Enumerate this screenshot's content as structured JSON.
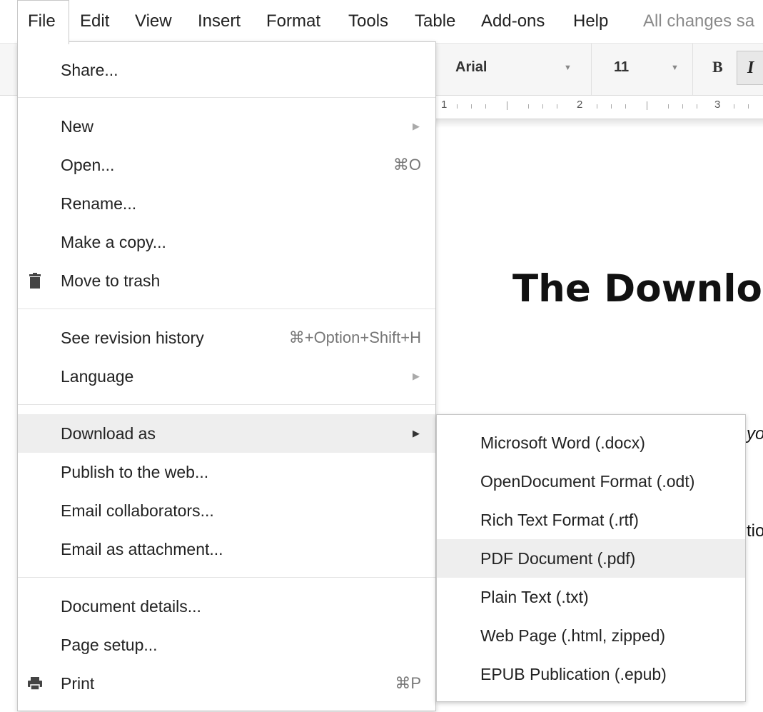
{
  "menubar": {
    "items": [
      "File",
      "Edit",
      "View",
      "Insert",
      "Format",
      "Tools",
      "Table",
      "Add-ons",
      "Help"
    ],
    "status": "All changes sa"
  },
  "toolbar": {
    "font": "Arial",
    "size": "11",
    "bold": "B",
    "italic": "I"
  },
  "ruler": {
    "marks": [
      "1",
      "2",
      "3"
    ]
  },
  "document": {
    "title": "The Downloa",
    "fragment1": "yo",
    "fragment2": "tio"
  },
  "file_menu": {
    "share": "Share...",
    "new": "New",
    "open": "Open...",
    "open_shortcut": "⌘O",
    "rename": "Rename...",
    "make_copy": "Make a copy...",
    "move_trash": "Move to trash",
    "revision_history": "See revision history",
    "revision_shortcut": "⌘+Option+Shift+H",
    "language": "Language",
    "download_as": "Download as",
    "publish": "Publish to the web...",
    "email_collab": "Email collaborators...",
    "email_attach": "Email as attachment...",
    "doc_details": "Document details...",
    "page_setup": "Page setup...",
    "print": "Print",
    "print_shortcut": "⌘P"
  },
  "download_submenu": {
    "items": [
      "Microsoft Word (.docx)",
      "OpenDocument Format (.odt)",
      "Rich Text Format (.rtf)",
      "PDF Document (.pdf)",
      "Plain Text (.txt)",
      "Web Page (.html, zipped)",
      "EPUB Publication (.epub)"
    ],
    "highlighted": "PDF Document (.pdf)"
  },
  "icons": {
    "trash": "trash-icon",
    "print": "printer-icon",
    "submenu_arrow": "triangle-right-icon",
    "dropdown_caret": "caret-down-icon"
  }
}
